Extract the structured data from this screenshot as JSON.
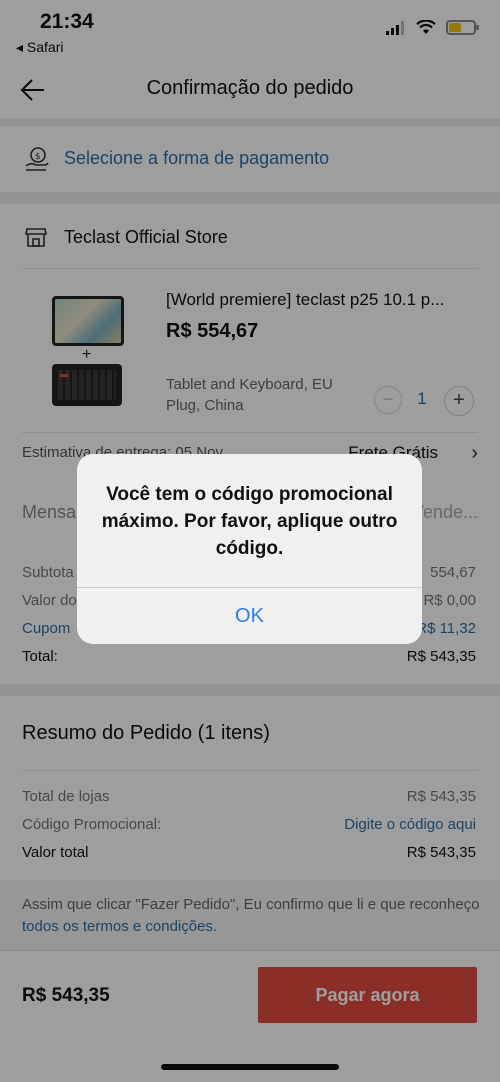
{
  "status_bar": {
    "time": "21:34",
    "back_app": "◂ Safari"
  },
  "header": {
    "title": "Confirmação do pedido"
  },
  "payment": {
    "label": "Selecione a forma de pagamento"
  },
  "store": {
    "name": "Teclast Official Store"
  },
  "product": {
    "name": "[World premiere] teclast p25 10.1 p...",
    "price": "R$ 554,67",
    "variant": "Tablet and Keyboard, EU Plug, China",
    "plus_sign": "+",
    "qty_minus": "−",
    "quantity": "1",
    "qty_plus": "+"
  },
  "delivery": {
    "label": "Estimativa de entrega: 05 Nov",
    "shipping": "Frete Grátis",
    "chevron": "›"
  },
  "message": {
    "label": "Mensa",
    "placeholder": "o Vende..."
  },
  "store_summary": {
    "subtotal_label": "Subtota",
    "subtotal_value": "554,67",
    "shipping_label": "Valor do",
    "shipping_value": "R$ 0,00",
    "coupon_label": "Cupom",
    "coupon_value": "R$ 11,32",
    "total_label": "Total:",
    "total_value": "R$ 543,35"
  },
  "resumo": {
    "title": "Resumo do Pedido (1 itens)",
    "stores_label": "Total de lojas",
    "stores_value": "R$ 543,35",
    "promo_label": "Código Promocional:",
    "promo_value": "Digite o código aqui",
    "total_label": "Valor total",
    "total_value": "R$ 543,35"
  },
  "terms": {
    "text": "Assim que clicar \"Fazer Pedido\", Eu confirmo que li e que reconheço ",
    "link": "todos os termos e condições."
  },
  "footer": {
    "total": "R$ 543,35",
    "pay_button": "Pagar agora"
  },
  "alert": {
    "message": "Você tem o código promocional máximo. Por favor, aplique outro código.",
    "ok_button": "OK"
  },
  "colors": {
    "accent_blue": "#2f6fa6",
    "pay_red": "#e04b3f",
    "ios_blue": "#2f7ce8"
  }
}
